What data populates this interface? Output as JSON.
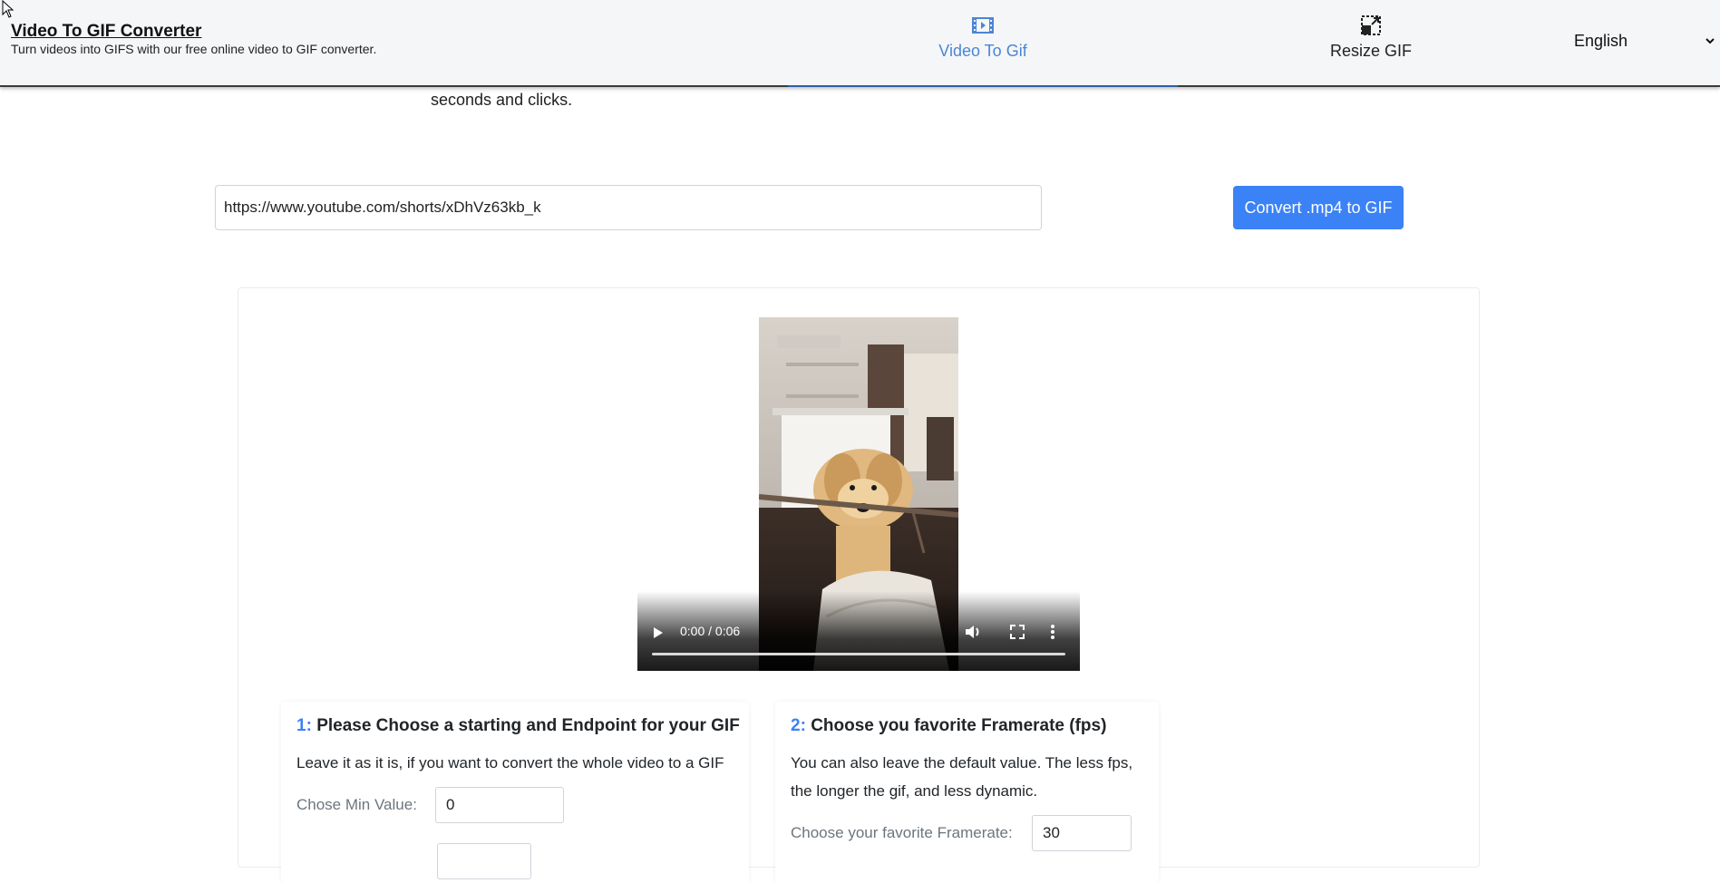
{
  "header": {
    "title": "Video To GIF Converter",
    "subtitle": "Turn videos into GIFS with our free online video to GIF converter.",
    "nav": [
      {
        "label": "Video To Gif",
        "icon": "film-icon",
        "active": true
      },
      {
        "label": "Resize GIF",
        "icon": "resize-icon",
        "active": false
      }
    ],
    "language": "English"
  },
  "intro": {
    "text": "seconds and clicks."
  },
  "url_form": {
    "value": "https://www.youtube.com/shorts/xDhVz63kb_k",
    "button_label": "Convert .mp4 to GIF"
  },
  "video": {
    "time": "0:00 / 0:06"
  },
  "step1": {
    "num": "1:",
    "title": "Please Choose a starting and Endpoint for your GIF",
    "description": "Leave it as it is, if you want to convert the whole video to a GIF",
    "min_label": "Chose Min Value:",
    "min_value": "0"
  },
  "step2": {
    "num": "2:",
    "title": "Choose you favorite Framerate (fps)",
    "description": "You can also leave the default value. The less fps, the longer the gif, and less dynamic.",
    "fps_label": "Choose your favorite Framerate:",
    "fps_value": "30"
  },
  "colors": {
    "accent": "#3b82f6",
    "nav_active": "#4a86d6",
    "header_bg": "#f5f6f7"
  }
}
